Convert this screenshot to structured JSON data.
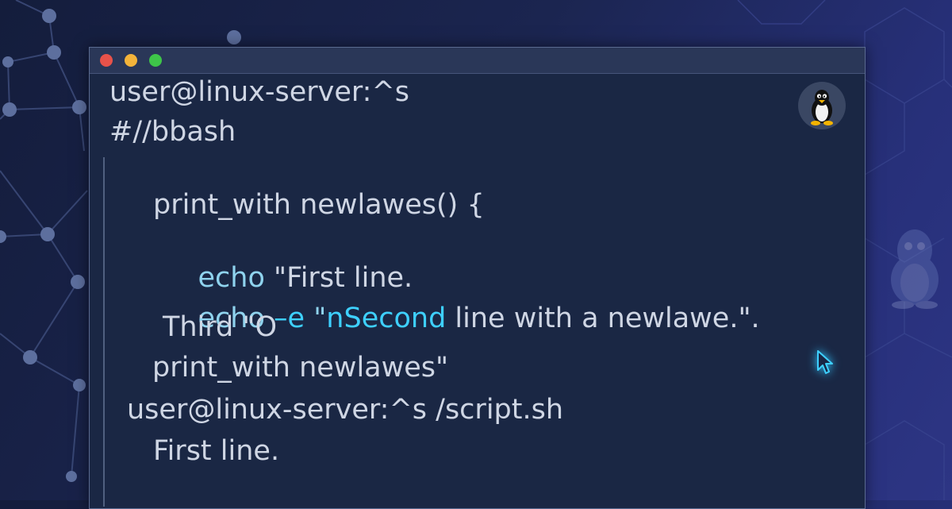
{
  "terminal": {
    "title_bar": {
      "buttons": [
        "close",
        "minimize",
        "maximize"
      ],
      "colors": {
        "close": "#e8524a",
        "minimize": "#f3b33a",
        "maximize": "#3ec549"
      }
    },
    "lines": {
      "prompt1": "user@linux-server:^s",
      "shebang": "#//bbash",
      "func_def": "print_with newlawes() {",
      "echo1_cmd": "echo",
      "echo1_rest": " \"First line.",
      "echo2_cmd": "echo",
      "echo2_flag": " –e",
      "echo2_quote": " \"",
      "echo2_highlight": "nSecond",
      "echo2_rest": " line with a newlawe.\".",
      "third": "Third \"O",
      "call": "print_with newlawes\"",
      "prompt2": "user@linux-server:^s /script.sh",
      "output1": "First line."
    },
    "colors": {
      "background": "#1a2744",
      "text": "#cfd6e4",
      "keyword": "#8fd3ee",
      "highlight": "#3ed0ff"
    }
  },
  "icons": [
    "tux-penguin-icon",
    "mouse-cursor-icon",
    "ghost-tux-icon"
  ],
  "background": {
    "gradient": [
      "#141d3c",
      "#2d3584"
    ],
    "pattern": "network-nodes and hexagons"
  }
}
